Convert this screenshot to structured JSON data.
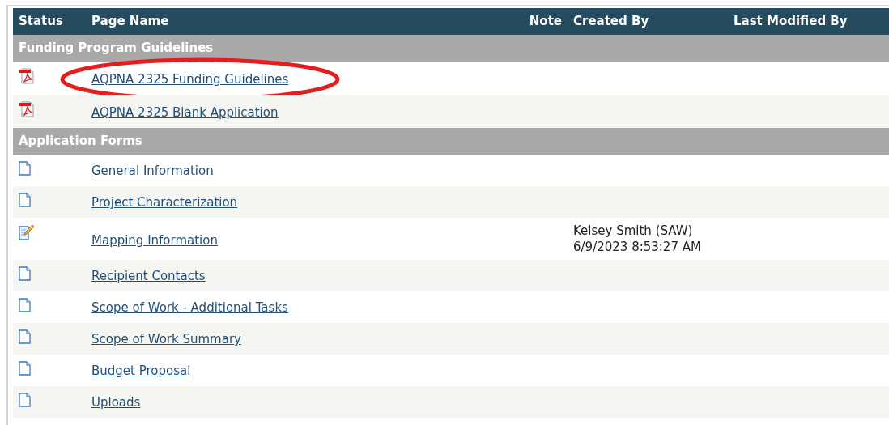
{
  "table": {
    "columns": [
      "Status",
      "Page Name",
      "Note",
      "Created By",
      "Last Modified By"
    ],
    "groups": [
      {
        "title": "Funding Program Guidelines",
        "rows": [
          {
            "kind": "pdf",
            "page_name": "AQPNA 2325 Funding Guidelines",
            "circled": true
          },
          {
            "kind": "pdf",
            "page_name": "AQPNA 2325 Blank Application",
            "circled": false
          }
        ]
      },
      {
        "title": "Application Forms",
        "rows": [
          {
            "kind": "page",
            "page_name": "General Information",
            "circled": false
          },
          {
            "kind": "page",
            "page_name": "Project Characterization",
            "circled": false
          },
          {
            "kind": "edited",
            "page_name": "Mapping Information",
            "circled": false,
            "created_by": [
              "Kelsey Smith (SAW)",
              "6/9/2023 8:53:27 AM"
            ]
          },
          {
            "kind": "page",
            "page_name": "Recipient Contacts",
            "circled": false
          },
          {
            "kind": "page",
            "page_name": "Scope of Work - Additional Tasks",
            "circled": false
          },
          {
            "kind": "page",
            "page_name": "Scope of Work Summary",
            "circled": false
          },
          {
            "kind": "page",
            "page_name": "Budget Proposal",
            "circled": false
          },
          {
            "kind": "page",
            "page_name": "Uploads",
            "circled": false
          }
        ]
      }
    ]
  }
}
